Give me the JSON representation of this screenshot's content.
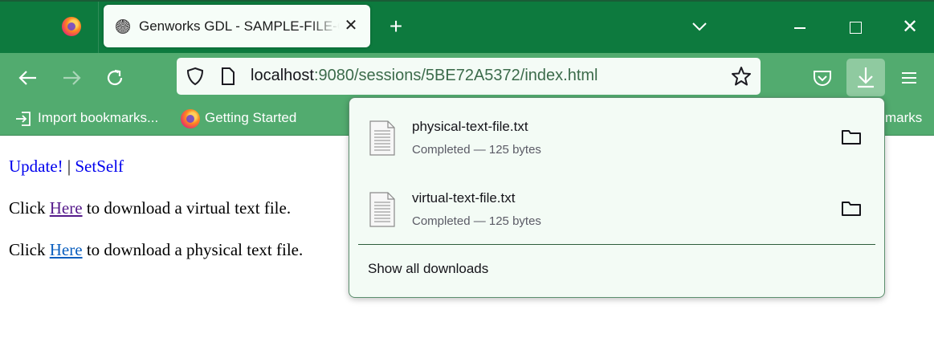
{
  "browser": {
    "tab": {
      "title": "Genworks GDL - SAMPLE-FILE-OUTPUT",
      "close_glyph": "✕",
      "favicon": "gdl-favicon-icon"
    },
    "new_tab_glyph": "+",
    "window_close_glyph": "✕",
    "url": {
      "host": "localhost",
      "path": ":9080/sessions/5BE72A5372/index.html"
    },
    "icons": [
      "back-arrow-icon",
      "forward-arrow-icon",
      "reload-icon",
      "shield-icon",
      "page-icon",
      "star-icon",
      "pocket-icon",
      "download-icon",
      "hamburger-menu-icon"
    ],
    "colors": {
      "tabstrip": "#0d7a3e",
      "toolbar": "#52ab6f",
      "panel_bg": "#f3fbf5"
    }
  },
  "bookmarks": {
    "import_label": "Import bookmarks...",
    "getting_started_label": "Getting Started",
    "other_label": "marks"
  },
  "page": {
    "update_link": "Update!",
    "separator": "|",
    "setself_link": "SetSelf",
    "virtual_prefix": "Click ",
    "virtual_link": "Here",
    "virtual_suffix": " to download a virtual text file.",
    "physical_prefix": "Click ",
    "physical_link": "Here",
    "physical_suffix": " to download a physical text file."
  },
  "downloads_panel": {
    "items": [
      {
        "filename": "physical-text-file.txt",
        "status": "Completed — 125 bytes"
      },
      {
        "filename": "virtual-text-file.txt",
        "status": "Completed — 125 bytes"
      }
    ],
    "show_all_label": "Show all downloads"
  }
}
